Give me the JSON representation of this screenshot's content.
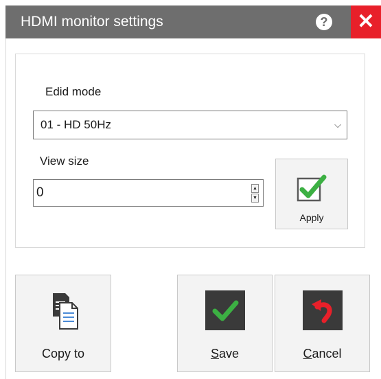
{
  "window": {
    "title": "HDMI monitor settings",
    "help_glyph": "?",
    "close_glyph": "✕"
  },
  "form": {
    "edid_label": "Edid mode",
    "edid_value": "01 - HD 50Hz",
    "view_size_label": "View size",
    "view_size_value": "0",
    "apply_label": "Apply"
  },
  "buttons": {
    "copy_to": "Copy to",
    "save_mnemonic": "S",
    "save_rest": "ave",
    "cancel_mnemonic": "C",
    "cancel_rest": "ancel"
  },
  "icons": {
    "help": "question-circle-icon",
    "close": "close-x-icon",
    "dropdown": "chevron-down-icon",
    "apply": "checkbox-check-icon",
    "copy": "copy-documents-icon",
    "save": "green-check-icon",
    "cancel": "undo-arrow-icon"
  },
  "colors": {
    "titlebar": "#6e6e6e",
    "close": "#e8202a",
    "accent_green": "#3cb043",
    "save_tile": "#3a3a3a",
    "cancel_tile": "#3a3a3a",
    "cancel_arrow": "#e8202a"
  }
}
